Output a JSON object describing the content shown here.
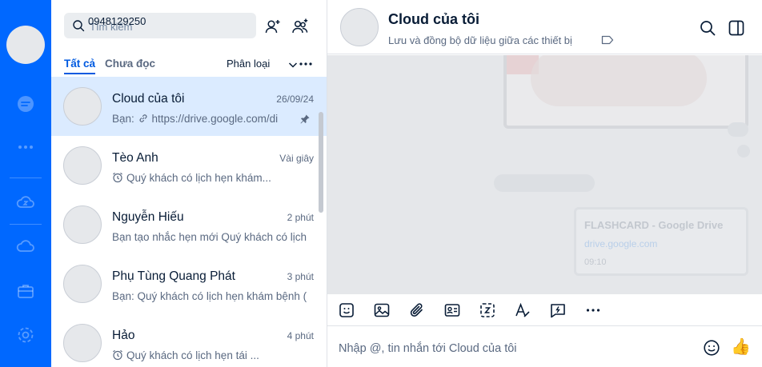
{
  "search": {
    "placeholder": "Tìm kiếm",
    "value": "0948129250"
  },
  "tabs": {
    "all": "Tất cả",
    "unread": "Chưa đọc",
    "classify": "Phân loại"
  },
  "conversations": [
    {
      "name": "Cloud của tôi",
      "time": "26/09/24",
      "preview": "Bạn: ",
      "preview_link": "https://drive.google.com/di",
      "pinned": true,
      "selected": true
    },
    {
      "name": "Tèo Anh",
      "time": "Vài giây",
      "preview": "Quý khách có lịch hẹn khám..."
    },
    {
      "name": "Nguyễn Hiếu",
      "time": "2 phút",
      "preview": "Bạn tạo nhắc hẹn mới Quý khách có lịch"
    },
    {
      "name": "Phụ Tùng Quang Phát",
      "time": "3 phút",
      "preview": "Bạn: Quý khách có lịch hẹn khám bệnh ("
    },
    {
      "name": "Hảo",
      "time": "4 phút",
      "preview": "Quý khách có lịch hẹn tái ..."
    }
  ],
  "chat": {
    "title": "Cloud của tôi",
    "subtitle": "Lưu và đồng bộ dữ liệu giữa các thiết bị",
    "link_card": {
      "title": "FLASHCARD - Google Drive",
      "domain": "drive.google.com",
      "time": "09:10"
    },
    "composer_placeholder": "Nhập @, tin nhắn tới Cloud của tôi",
    "quick_reaction": "👍"
  },
  "colors": {
    "rail": "#0068ff",
    "accent": "#005ae0",
    "selected_row": "#dbebff",
    "chat_bg": "#e5e7ea"
  }
}
